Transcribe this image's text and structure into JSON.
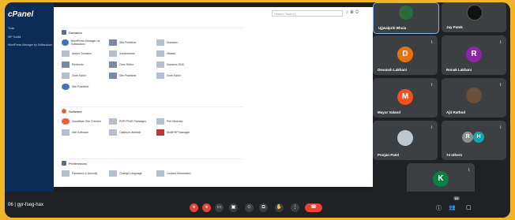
{
  "cpanel": {
    "logo": "cPanel",
    "nav": [
      "Tools",
      "WP Toolkit",
      "WordPress Manager by Softaculous"
    ],
    "search_placeholder": "Search Tools (/)",
    "sections": [
      {
        "title": "Domains",
        "color": "#5a6b8c",
        "tools": [
          "WordPress Manager by Softaculous",
          "Site Publisher",
          "Domains",
          "Addon Domains",
          "Subdomains",
          "Aliases",
          "Redirects",
          "Zone Editor",
          "Dynamic DNS",
          "Zone Editor",
          "Site Publisher",
          "Zone Editor",
          "Site Publisher"
        ]
      },
      {
        "title": "Software",
        "color": "#e7613a",
        "tools": [
          "Cloudflare Site Checker",
          "PHP PEAR Packages",
          "Perl Modules",
          "Site Software",
          "Optimize Website",
          "MultiPHP Manager"
        ]
      },
      {
        "title": "Preferences",
        "color": "#5a6b8c",
        "tools": [
          "Password & Security",
          "Change Language",
          "Contact Information"
        ]
      }
    ]
  },
  "participants": [
    {
      "name": "Ujjwalpriti Bhuia",
      "initial": "",
      "color": "#2b6c3f",
      "active": true
    },
    {
      "name": "Jay Patek",
      "initial": "",
      "color": "#1b1b1b",
      "active": false
    },
    {
      "name": "Devansh Lakhani",
      "initial": "D",
      "color": "#e8710a",
      "active": false
    },
    {
      "name": "Ronak Lakhani",
      "initial": "R",
      "color": "#8e24aa",
      "active": false
    },
    {
      "name": "Mayur Valand",
      "initial": "M",
      "color": "#f4511e",
      "active": false
    },
    {
      "name": "Ajit Rathod",
      "initial": "",
      "color": "#6b4f3a",
      "active": false
    },
    {
      "name": "Poojan Patel",
      "initial": "",
      "color": "#bfc7cf",
      "active": false
    },
    {
      "name": "74 others",
      "initial": "R",
      "color": "#8e8e8e",
      "active": false
    },
    {
      "name": "You",
      "initial": "K",
      "color": "#0b8043",
      "active": false
    }
  ],
  "meeting": {
    "code": "gyr-fseg-hax",
    "time_prefix": "06"
  },
  "badges": {
    "people_count": "84",
    "reactions": "1"
  }
}
